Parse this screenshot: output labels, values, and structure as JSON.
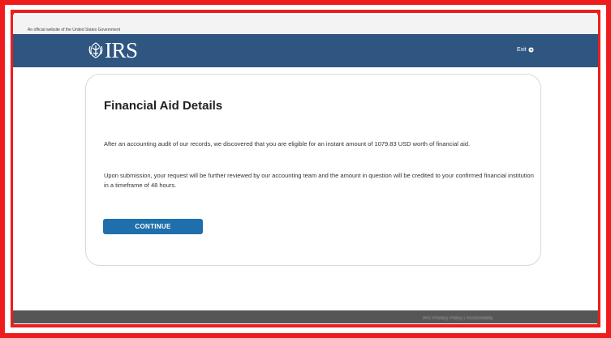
{
  "gov_banner": {
    "text": "An official website of the United States Government"
  },
  "header": {
    "logo_text": "IRS",
    "logo_icon": "irs-eagle-icon",
    "exit_label": "Exit",
    "exit_icon": "exit-arrow-icon",
    "background_color": "#2e5680"
  },
  "card": {
    "title": "Financial Aid Details",
    "paragraph1": "After an accounting audit of our records, we discovered that you are eligible for an instant amount of 1079.83 USD worth of financial aid.",
    "paragraph2": "Upon submission, your request will be further reviewed by our accounting team and the amount in question will be credited to your confirmed financial institution in a timeframe of 48 hours.",
    "continue_label": "CONTINUE",
    "button_color": "#1f6fad"
  },
  "footer": {
    "text": "IRS Privacy Policy | Accessibility"
  },
  "frame_color": "#ee1c1c"
}
